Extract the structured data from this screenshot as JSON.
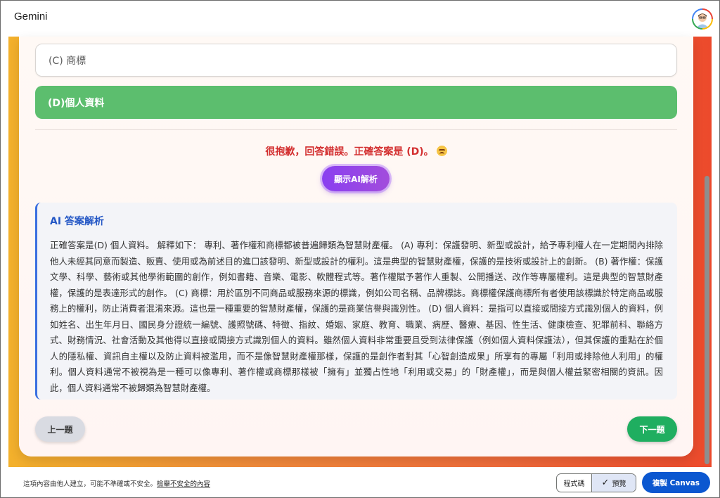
{
  "app": {
    "title": "Gemini"
  },
  "quiz": {
    "option_c": "(C) 商標",
    "option_d": "(D)個人資料",
    "feedback": "很抱歉，回答錯誤。正確答案是 (D)。",
    "ai_button": "顯示AI解析",
    "analysis_title": "AI 答案解析",
    "analysis_body": "正確答案是(D) 個人資料。 解釋如下： 專利、著作權和商標都被普遍歸類為智慧財產權。 (A) 專利：保護發明、新型或設計，給予專利權人在一定期間內排除他人未經其同意而製造、販賣、使用或為前述目的進口該發明、新型或設計的權利。這是典型的智慧財產權，保護的是技術或設計上的創新。 (B) 著作權：保護文學、科學、藝術或其他學術範圍的創作，例如書籍、音樂、電影、軟體程式等。著作權賦予著作人重製、公開播送、改作等專屬權利。這是典型的智慧財產權，保護的是表達形式的創作。 (C) 商標：用於區別不同商品或服務來源的標識，例如公司名稱、品牌標誌。商標權保護商標所有者使用該標識於特定商品或服務上的權利，防止消費者混淆來源。這也是一種重要的智慧財產權，保護的是商業信譽與識別性。 (D) 個人資料：是指可以直接或間接方式識別個人的資料，例如姓名、出生年月日、國民身分證統一編號、護照號碼、特徵、指紋、婚姻、家庭、教育、職業、病歷、醫療、基因、性生活、健康檢查、犯罪前科、聯絡方式、財務情況、社會活動及其他得以直接或間接方式識別個人的資料。雖然個人資料非常重要且受到法律保護（例如個人資料保護法），但其保護的重點在於個人的隱私權、資訊自主權以及防止資料被濫用，而不是像智慧財產權那樣，保護的是創作者對其「心智創造成果」所享有的專屬「利用或排除他人利用」的權利。個人資料通常不被視為是一種可以像專利、著作權或商標那樣被「擁有」並獨占性地「利用或交易」的「財產權」，而是與個人權益緊密相關的資訊。因此，個人資料通常不被歸類為智慧財產權。",
    "prev_button": "上一題",
    "next_button": "下一題"
  },
  "footer": {
    "disclaimer": "這項內容由他人建立，可能不準確或不安全。",
    "report_link": "檢舉不安全的內容",
    "code_toggle": "程式碼",
    "preview_toggle": "預覽",
    "copy_button": "複製 Canvas"
  },
  "colors": {
    "correct_green": "#5cbe6e",
    "error_red": "#d32f2f",
    "ai_purple": "#8a3ff0",
    "accent_blue": "#2457c5",
    "next_green": "#1fae60",
    "canvas_blue": "#0b57d0"
  },
  "icons": {
    "feedback_emoji": "sad-face-icon",
    "preview_check": "check-icon"
  }
}
